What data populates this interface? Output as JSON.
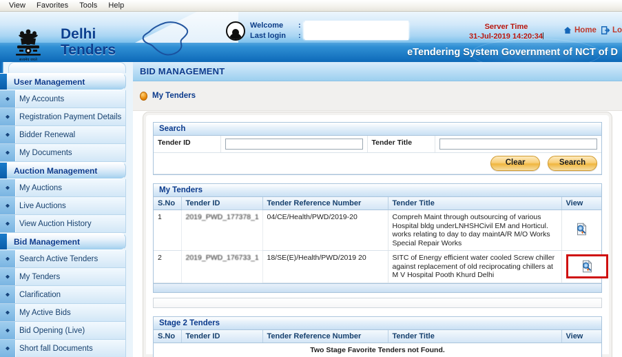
{
  "browser_menu": [
    "View",
    "Favorites",
    "Tools",
    "Help"
  ],
  "header": {
    "brand_line1": "Delhi",
    "brand_line2": "Tenders",
    "emblem_caption": "सत्यमेव जयते",
    "welcome_label": "Welcome",
    "last_login_label": "Last login",
    "colon": ":",
    "welcome_value": "",
    "last_login_value": "",
    "server_time_label": "Server Time",
    "server_time_value": "31-Jul-2019 14:20:34",
    "home_link": "Home",
    "logout_link": "Lo",
    "tagline": "eTendering System Government of NCT of D",
    "accent_blue": "#0b3a8c",
    "server_time_color": "#b3140e"
  },
  "sidebar": {
    "groups": [
      {
        "title": "User Management",
        "items": [
          {
            "label": "My Accounts"
          },
          {
            "label": "Registration Payment Details"
          },
          {
            "label": "Bidder Renewal"
          },
          {
            "label": "My Documents"
          }
        ]
      },
      {
        "title": "Auction Management",
        "items": [
          {
            "label": "My Auctions"
          },
          {
            "label": "Live Auctions"
          },
          {
            "label": "View Auction History"
          }
        ]
      },
      {
        "title": "Bid Management",
        "items": [
          {
            "label": "Search Active Tenders"
          },
          {
            "label": "My Tenders"
          },
          {
            "label": "Clarification"
          },
          {
            "label": "My Active Bids"
          },
          {
            "label": "Bid Opening (Live)"
          },
          {
            "label": "Short fall Documents"
          }
        ]
      }
    ]
  },
  "content": {
    "page_title": "BID MANAGEMENT",
    "breadcrumb": "My Tenders",
    "search": {
      "title": "Search",
      "tender_id_label": "Tender ID",
      "tender_id_value": "",
      "tender_title_label": "Tender Title",
      "tender_title_value": "",
      "clear_button": "Clear",
      "search_button": "Search"
    },
    "my_tenders": {
      "title": "My Tenders",
      "columns": [
        "S.No",
        "Tender ID",
        "Tender Reference Number",
        "Tender Title",
        "View"
      ],
      "rows": [
        {
          "sno": "1",
          "tender_id": "2019_PWD_177378_1",
          "reference_number": "04/CE/Health/PWD/2019-20",
          "tender_title": "Compreh Maint through outsourcing of various Hospital bldg underLNHSHCivil EM and Horticul. works relating to day to day maintA/R M/O Works Special Repair Works",
          "view_icon": "document-search-icon",
          "highlighted": false
        },
        {
          "sno": "2",
          "tender_id": "2019_PWD_176733_1",
          "reference_number": "18/SE(E)/Health/PWD/2019 20",
          "tender_title": "SITC of Energy efficient water cooled Screw chiller against replacement of old reciprocating chillers at M V Hospital Pooth Khurd Delhi",
          "view_icon": "document-search-icon",
          "highlighted": true
        }
      ]
    },
    "stage2": {
      "title": "Stage 2 Tenders",
      "columns": [
        "S.No",
        "Tender ID",
        "Tender Reference Number",
        "Tender Title",
        "View"
      ],
      "empty_message": "Two Stage Favorite Tenders not Found."
    },
    "highlight_color": "#cf1010"
  }
}
